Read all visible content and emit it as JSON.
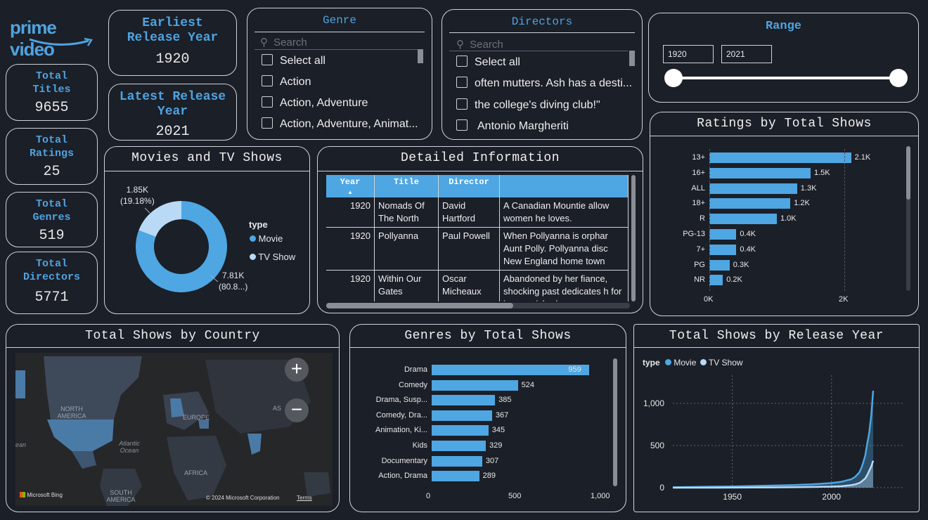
{
  "brand": {
    "logo_text": "prime video"
  },
  "kpis": [
    {
      "title": "Total Titles",
      "value": "9655"
    },
    {
      "title": "Total Ratings",
      "value": "25"
    },
    {
      "title": "Total Genres",
      "value": "519"
    },
    {
      "title": "Total Directors",
      "value": "5771"
    }
  ],
  "release": {
    "earliest_title": "Earliest Release Year",
    "earliest_value": "1920",
    "latest_title": "Latest Release Year",
    "latest_value": "2021"
  },
  "genre_slicer": {
    "title": "Genre",
    "placeholder": "Search",
    "options": [
      "Select all",
      "Action",
      "Action, Adventure",
      "Action, Adventure, Animat..."
    ]
  },
  "directors_slicer": {
    "title": "Directors",
    "placeholder": "Search",
    "options": [
      "Select all",
      "often mutters. Ash has a desti...",
      "the college's diving club!\"",
      "Antonio Margheriti"
    ]
  },
  "range": {
    "title": "Range",
    "min": "1920",
    "max": "2021"
  },
  "donut": {
    "title": "Movies and TV Shows",
    "legend_title": "type",
    "movie_label": "Movie",
    "tv_label": "TV Show",
    "tv_value": "1.85K",
    "tv_pct": "(19.18%)",
    "movie_value": "7.81K",
    "movie_pct": "(80.8...)",
    "movie_share": 0.8082,
    "colors": {
      "movie": "#4ea6e2",
      "tv": "#b9d9f7"
    }
  },
  "details": {
    "title": "Detailed Information",
    "columns": [
      "Year",
      "Title",
      "Director",
      ""
    ],
    "rows": [
      {
        "year": "1920",
        "title": "Nomads Of The North",
        "director": "David Hartford",
        "desc": "A Canadian Mountie allow women he loves."
      },
      {
        "year": "1920",
        "title": "Pollyanna",
        "director": "Paul Powell",
        "desc": "When Pollyanna is orphar Aunt Polly. Pollyanna disc New England home town"
      },
      {
        "year": "1920",
        "title": "Within Our Gates",
        "director": "Oscar Micheaux",
        "desc": "Abandoned by her fiance, shocking past dedicates h for impoverished negro yo"
      }
    ]
  },
  "ratings_panel": {
    "title": "Ratings by Total Shows"
  },
  "country_panel": {
    "title": "Total Shows by Country",
    "map_labels": [
      "NORTH AMERICA",
      "EUROPE",
      "AFRICA",
      "SOUTH AMERICA",
      "Atlantic Ocean",
      "AS",
      "ean"
    ],
    "bing": "Microsoft Bing",
    "copyright": "© 2024 Microsoft Corporation",
    "terms": "Terms"
  },
  "genres_panel": {
    "title": "Genres by Total Shows"
  },
  "year_panel": {
    "title": "Total Shows by Release Year",
    "legend_title": "type",
    "legend": [
      "Movie",
      "TV Show"
    ]
  },
  "chart_data": [
    {
      "type": "bar",
      "orientation": "horizontal",
      "categories": [
        "13+",
        "16+",
        "ALL",
        "18+",
        "R",
        "PG-13",
        "7+",
        "PG",
        "NR"
      ],
      "values": [
        2100,
        1500,
        1300,
        1200,
        1000,
        400,
        400,
        300,
        200
      ],
      "data_labels": [
        "2.1K",
        "1.5K",
        "1.3K",
        "1.2K",
        "1.0K",
        "0.4K",
        "0.4K",
        "0.3K",
        "0.2K"
      ],
      "xticks": [
        "0K",
        "2K"
      ],
      "xlim": [
        0,
        2500
      ],
      "color": "#4ea6e2"
    },
    {
      "type": "bar",
      "orientation": "horizontal",
      "categories": [
        "Drama",
        "Comedy",
        "Drama, Susp...",
        "Comedy, Dra...",
        "Animation, Ki...",
        "Kids",
        "Documentary",
        "Action, Drama"
      ],
      "values": [
        959,
        524,
        385,
        367,
        345,
        329,
        307,
        289
      ],
      "xticks": [
        "0",
        "500",
        "1,000"
      ],
      "xlim": [
        0,
        1000
      ],
      "color": "#4ea6e2"
    },
    {
      "type": "area",
      "x": [
        1920,
        1930,
        1940,
        1950,
        1960,
        1970,
        1980,
        1990,
        2000,
        2005,
        2010,
        2012,
        2014,
        2015,
        2016,
        2017,
        2018,
        2019,
        2020,
        2021
      ],
      "series": [
        {
          "name": "Movie",
          "values": [
            5,
            8,
            12,
            15,
            20,
            25,
            30,
            40,
            55,
            70,
            100,
            130,
            180,
            230,
            300,
            380,
            520,
            650,
            850,
            1150
          ]
        },
        {
          "name": "TV Show",
          "values": [
            0,
            0,
            0,
            1,
            2,
            3,
            5,
            8,
            12,
            18,
            30,
            40,
            55,
            70,
            90,
            110,
            150,
            200,
            250,
            320
          ]
        }
      ],
      "yticks": [
        "0",
        "500",
        "1,000"
      ],
      "xticks": [
        "1950",
        "2000"
      ],
      "ylim": [
        0,
        1250
      ],
      "xlim": [
        1920,
        2021
      ],
      "colors": {
        "Movie": "#4ea6e2",
        "TV Show": "#b9d9f7"
      }
    }
  ]
}
